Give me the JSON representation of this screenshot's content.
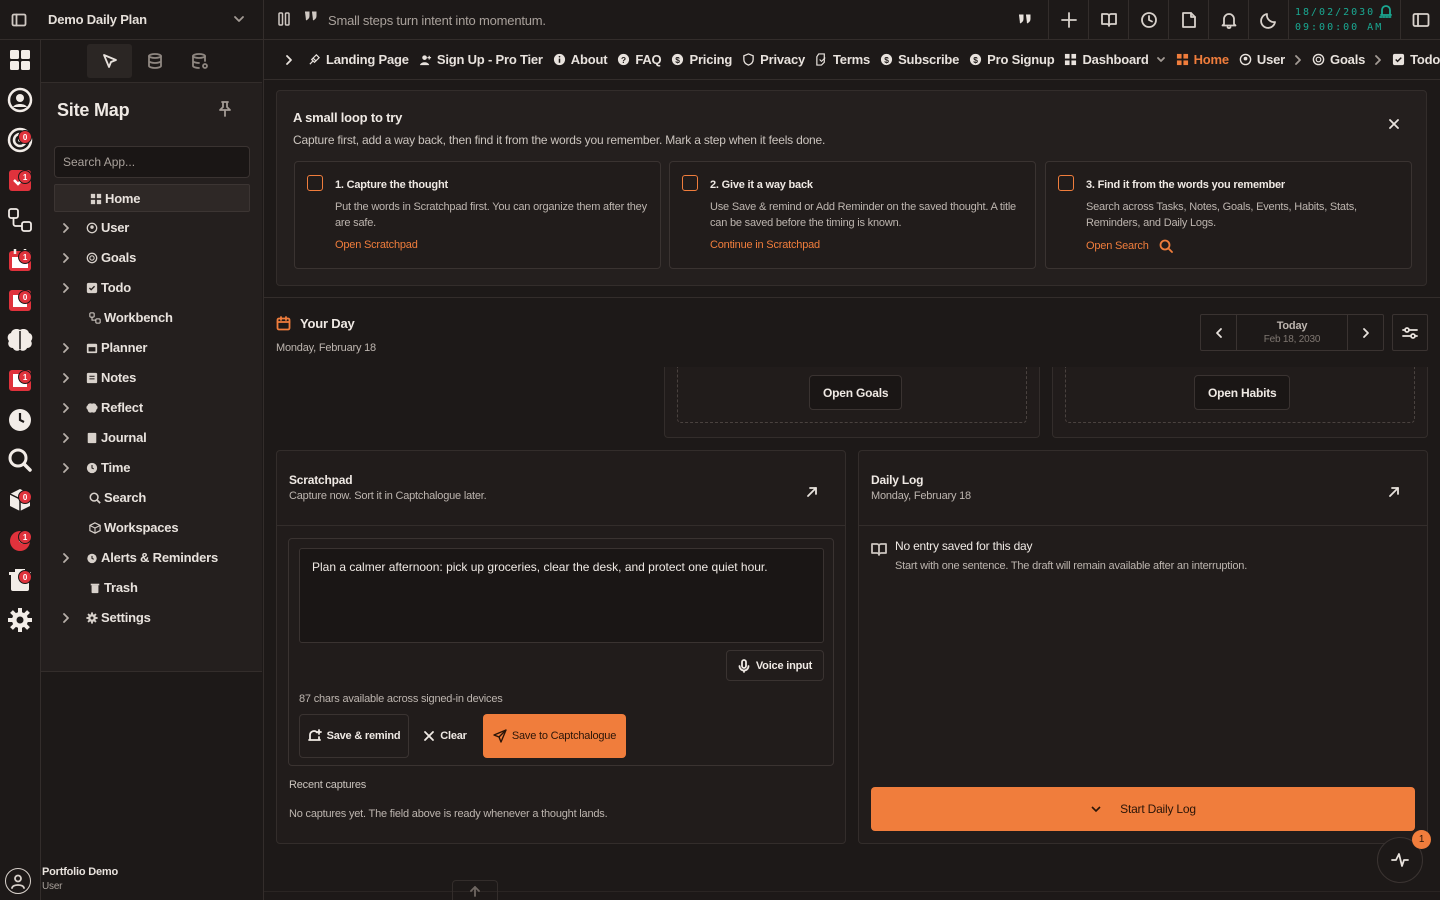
{
  "workspace": {
    "name": "Demo Daily Plan"
  },
  "topbar": {
    "tagline": "Small steps turn intent into momentum.",
    "clock_date": "18/02/2030",
    "clock_time": "09:00:00 AM"
  },
  "rail": {
    "badges": [
      "0",
      "1",
      "1",
      "0",
      "1",
      "0",
      "1",
      "0"
    ]
  },
  "sidebar": {
    "title": "Site Map",
    "search_placeholder": "Search App...",
    "items": [
      {
        "label": "Home",
        "icon": "grid-icon"
      },
      {
        "label": "User",
        "icon": "user-circle-icon"
      },
      {
        "label": "Goals",
        "icon": "target-icon"
      },
      {
        "label": "Todo",
        "icon": "checkbox-icon"
      },
      {
        "label": "Workbench",
        "icon": "workflow-icon"
      },
      {
        "label": "Planner",
        "icon": "calendar-icon"
      },
      {
        "label": "Notes",
        "icon": "note-icon"
      },
      {
        "label": "Reflect",
        "icon": "brain-icon"
      },
      {
        "label": "Journal",
        "icon": "book-icon"
      },
      {
        "label": "Time",
        "icon": "clock-icon"
      },
      {
        "label": "Search",
        "icon": "search-icon"
      },
      {
        "label": "Workspaces",
        "icon": "cube-icon"
      },
      {
        "label": "Alerts & Reminders",
        "icon": "alarm-icon"
      },
      {
        "label": "Trash",
        "icon": "trash-icon"
      },
      {
        "label": "Settings",
        "icon": "gear-icon"
      }
    ],
    "user": {
      "name": "Portfolio Demo",
      "role": "User"
    }
  },
  "nav": {
    "items": [
      "Landing Page",
      "Sign Up - Pro Tier",
      "About",
      "FAQ",
      "Pricing",
      "Privacy",
      "Terms",
      "Subscribe",
      "Pro Signup",
      "Dashboard",
      "Home",
      "User",
      "Goals",
      "Todo"
    ]
  },
  "loop": {
    "title": "A small loop to try",
    "subtitle": "Capture first, add a way back, then find it from the words you remember. Mark a step when it feels done.",
    "steps": [
      {
        "title": "1. Capture the thought",
        "desc": "Put the words in Scratchpad first. You can organize them after they are safe.",
        "link": "Open Scratchpad"
      },
      {
        "title": "2. Give it a way back",
        "desc": "Use Save & remind or Add Reminder on the saved thought. A title can be saved before the timing is known.",
        "link": "Continue in Scratchpad"
      },
      {
        "title": "3. Find it from the words you remember",
        "desc": "Search across Tasks, Notes, Goals, Events, Habits, Stats, Reminders, and Daily Logs.",
        "link": "Open Search"
      }
    ]
  },
  "day": {
    "title": "Your Day",
    "date": "Monday, February 18",
    "nav_today": "Today",
    "nav_date": "Feb 18, 2030",
    "open_goals": "Open Goals",
    "open_habits": "Open Habits"
  },
  "scratchpad": {
    "title": "Scratchpad",
    "subtitle": "Capture now. Sort it in Captchalogue later.",
    "text": "Plan a calmer afternoon: pick up groceries, clear the desk, and protect one quiet hour.",
    "voice": "Voice input",
    "chars": "87 chars available across signed-in devices",
    "save_remind": "Save & remind",
    "clear": "Clear",
    "save_capt": "Save to Captchalogue",
    "recent_label": "Recent captures",
    "recent_empty": "No captures yet. The field above is ready whenever a thought lands."
  },
  "dailylog": {
    "title": "Daily Log",
    "subtitle": "Monday, February 18",
    "empty_title": "No entry saved for this day",
    "empty_desc": "Start with one sentence. The draft will remain available after an interruption.",
    "start": "Start Daily Log"
  },
  "fab": {
    "badge": "1"
  },
  "colors": {
    "accent": "#f07d3c",
    "badge": "#e0323c",
    "clock": "#1aa892",
    "bg": "#1d1918"
  }
}
